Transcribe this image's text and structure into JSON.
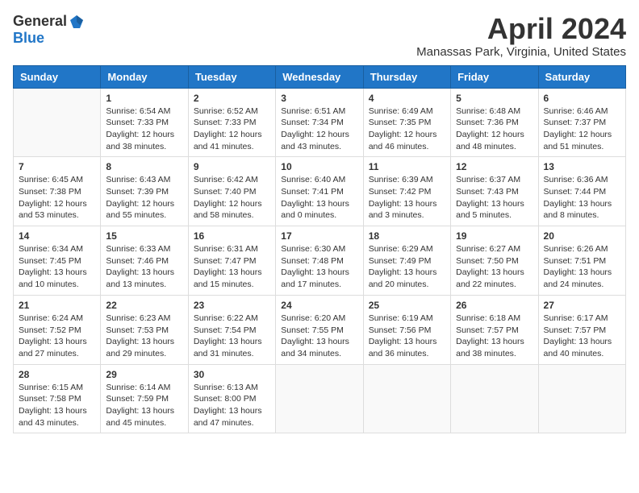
{
  "header": {
    "logo_general": "General",
    "logo_blue": "Blue",
    "month_title": "April 2024",
    "location": "Manassas Park, Virginia, United States"
  },
  "days_of_week": [
    "Sunday",
    "Monday",
    "Tuesday",
    "Wednesday",
    "Thursday",
    "Friday",
    "Saturday"
  ],
  "weeks": [
    [
      {
        "day": "",
        "sunrise": "",
        "sunset": "",
        "daylight": ""
      },
      {
        "day": "1",
        "sunrise": "Sunrise: 6:54 AM",
        "sunset": "Sunset: 7:33 PM",
        "daylight": "Daylight: 12 hours and 38 minutes."
      },
      {
        "day": "2",
        "sunrise": "Sunrise: 6:52 AM",
        "sunset": "Sunset: 7:33 PM",
        "daylight": "Daylight: 12 hours and 41 minutes."
      },
      {
        "day": "3",
        "sunrise": "Sunrise: 6:51 AM",
        "sunset": "Sunset: 7:34 PM",
        "daylight": "Daylight: 12 hours and 43 minutes."
      },
      {
        "day": "4",
        "sunrise": "Sunrise: 6:49 AM",
        "sunset": "Sunset: 7:35 PM",
        "daylight": "Daylight: 12 hours and 46 minutes."
      },
      {
        "day": "5",
        "sunrise": "Sunrise: 6:48 AM",
        "sunset": "Sunset: 7:36 PM",
        "daylight": "Daylight: 12 hours and 48 minutes."
      },
      {
        "day": "6",
        "sunrise": "Sunrise: 6:46 AM",
        "sunset": "Sunset: 7:37 PM",
        "daylight": "Daylight: 12 hours and 51 minutes."
      }
    ],
    [
      {
        "day": "7",
        "sunrise": "Sunrise: 6:45 AM",
        "sunset": "Sunset: 7:38 PM",
        "daylight": "Daylight: 12 hours and 53 minutes."
      },
      {
        "day": "8",
        "sunrise": "Sunrise: 6:43 AM",
        "sunset": "Sunset: 7:39 PM",
        "daylight": "Daylight: 12 hours and 55 minutes."
      },
      {
        "day": "9",
        "sunrise": "Sunrise: 6:42 AM",
        "sunset": "Sunset: 7:40 PM",
        "daylight": "Daylight: 12 hours and 58 minutes."
      },
      {
        "day": "10",
        "sunrise": "Sunrise: 6:40 AM",
        "sunset": "Sunset: 7:41 PM",
        "daylight": "Daylight: 13 hours and 0 minutes."
      },
      {
        "day": "11",
        "sunrise": "Sunrise: 6:39 AM",
        "sunset": "Sunset: 7:42 PM",
        "daylight": "Daylight: 13 hours and 3 minutes."
      },
      {
        "day": "12",
        "sunrise": "Sunrise: 6:37 AM",
        "sunset": "Sunset: 7:43 PM",
        "daylight": "Daylight: 13 hours and 5 minutes."
      },
      {
        "day": "13",
        "sunrise": "Sunrise: 6:36 AM",
        "sunset": "Sunset: 7:44 PM",
        "daylight": "Daylight: 13 hours and 8 minutes."
      }
    ],
    [
      {
        "day": "14",
        "sunrise": "Sunrise: 6:34 AM",
        "sunset": "Sunset: 7:45 PM",
        "daylight": "Daylight: 13 hours and 10 minutes."
      },
      {
        "day": "15",
        "sunrise": "Sunrise: 6:33 AM",
        "sunset": "Sunset: 7:46 PM",
        "daylight": "Daylight: 13 hours and 13 minutes."
      },
      {
        "day": "16",
        "sunrise": "Sunrise: 6:31 AM",
        "sunset": "Sunset: 7:47 PM",
        "daylight": "Daylight: 13 hours and 15 minutes."
      },
      {
        "day": "17",
        "sunrise": "Sunrise: 6:30 AM",
        "sunset": "Sunset: 7:48 PM",
        "daylight": "Daylight: 13 hours and 17 minutes."
      },
      {
        "day": "18",
        "sunrise": "Sunrise: 6:29 AM",
        "sunset": "Sunset: 7:49 PM",
        "daylight": "Daylight: 13 hours and 20 minutes."
      },
      {
        "day": "19",
        "sunrise": "Sunrise: 6:27 AM",
        "sunset": "Sunset: 7:50 PM",
        "daylight": "Daylight: 13 hours and 22 minutes."
      },
      {
        "day": "20",
        "sunrise": "Sunrise: 6:26 AM",
        "sunset": "Sunset: 7:51 PM",
        "daylight": "Daylight: 13 hours and 24 minutes."
      }
    ],
    [
      {
        "day": "21",
        "sunrise": "Sunrise: 6:24 AM",
        "sunset": "Sunset: 7:52 PM",
        "daylight": "Daylight: 13 hours and 27 minutes."
      },
      {
        "day": "22",
        "sunrise": "Sunrise: 6:23 AM",
        "sunset": "Sunset: 7:53 PM",
        "daylight": "Daylight: 13 hours and 29 minutes."
      },
      {
        "day": "23",
        "sunrise": "Sunrise: 6:22 AM",
        "sunset": "Sunset: 7:54 PM",
        "daylight": "Daylight: 13 hours and 31 minutes."
      },
      {
        "day": "24",
        "sunrise": "Sunrise: 6:20 AM",
        "sunset": "Sunset: 7:55 PM",
        "daylight": "Daylight: 13 hours and 34 minutes."
      },
      {
        "day": "25",
        "sunrise": "Sunrise: 6:19 AM",
        "sunset": "Sunset: 7:56 PM",
        "daylight": "Daylight: 13 hours and 36 minutes."
      },
      {
        "day": "26",
        "sunrise": "Sunrise: 6:18 AM",
        "sunset": "Sunset: 7:57 PM",
        "daylight": "Daylight: 13 hours and 38 minutes."
      },
      {
        "day": "27",
        "sunrise": "Sunrise: 6:17 AM",
        "sunset": "Sunset: 7:57 PM",
        "daylight": "Daylight: 13 hours and 40 minutes."
      }
    ],
    [
      {
        "day": "28",
        "sunrise": "Sunrise: 6:15 AM",
        "sunset": "Sunset: 7:58 PM",
        "daylight": "Daylight: 13 hours and 43 minutes."
      },
      {
        "day": "29",
        "sunrise": "Sunrise: 6:14 AM",
        "sunset": "Sunset: 7:59 PM",
        "daylight": "Daylight: 13 hours and 45 minutes."
      },
      {
        "day": "30",
        "sunrise": "Sunrise: 6:13 AM",
        "sunset": "Sunset: 8:00 PM",
        "daylight": "Daylight: 13 hours and 47 minutes."
      },
      {
        "day": "",
        "sunrise": "",
        "sunset": "",
        "daylight": ""
      },
      {
        "day": "",
        "sunrise": "",
        "sunset": "",
        "daylight": ""
      },
      {
        "day": "",
        "sunrise": "",
        "sunset": "",
        "daylight": ""
      },
      {
        "day": "",
        "sunrise": "",
        "sunset": "",
        "daylight": ""
      }
    ]
  ]
}
